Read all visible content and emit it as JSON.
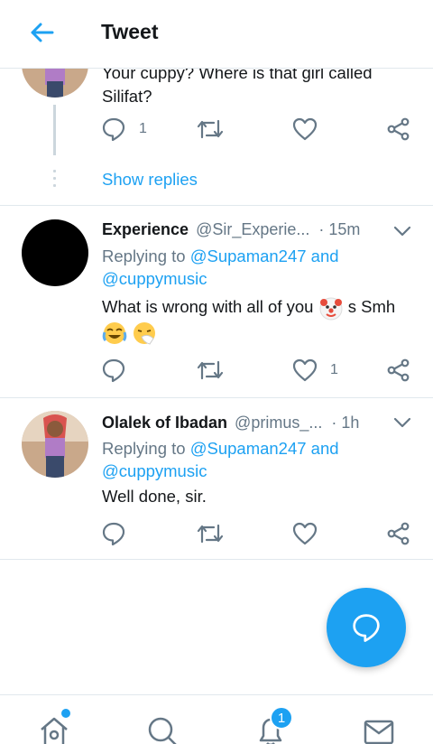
{
  "header": {
    "title": "Tweet",
    "back_icon": "back-arrow-icon"
  },
  "thread_parent": {
    "text": "Your cuppy? Where is that girl called Silifat?",
    "reply_count": "1",
    "show_replies_label": "Show replies"
  },
  "tweets": [
    {
      "name": "Experience",
      "handle": "@Sir_Experie...",
      "time": "· 15m",
      "replying_prefix": "Replying to",
      "replying_mentions": "@Supaman247 and @cuppymusic",
      "text_before_emoji": "What is wrong with all of you",
      "text_after_emoji": "s  Smh",
      "like_count": "1"
    },
    {
      "name": "Olalek of Ibadan",
      "handle": "@primus_...",
      "time": "· 1h",
      "replying_prefix": "Replying to",
      "replying_mentions": "@Supaman247 and @cuppymusic",
      "text": "Well done, sir."
    }
  ],
  "bottom_nav": {
    "notifications_badge": "1"
  },
  "colors": {
    "accent": "#1da1f2",
    "secondary_text": "#657786",
    "border": "#e1e8ed"
  }
}
